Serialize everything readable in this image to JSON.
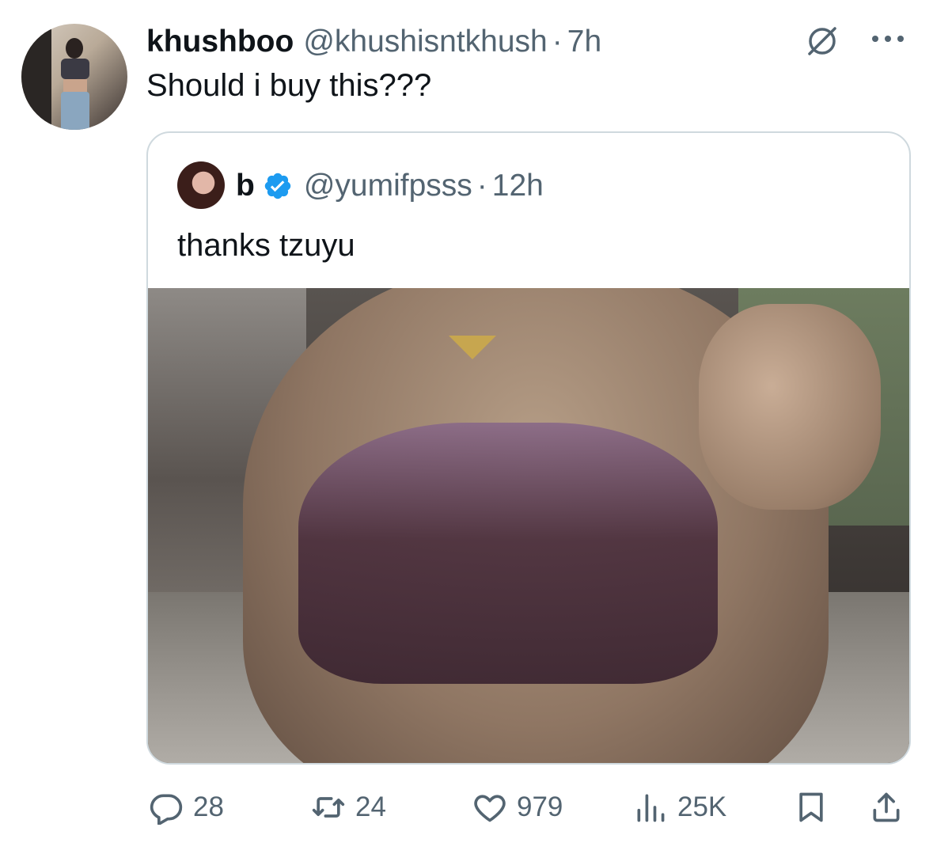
{
  "tweet": {
    "author_name": "khushboo",
    "author_handle": "@khushisntkhush",
    "separator": "·",
    "time": "7h",
    "text": "Should i buy this???",
    "avatar_icon": "user-avatar-photo",
    "grok_icon": "grok-icon",
    "more_icon": "more-horizontal-icon"
  },
  "quote": {
    "author_name": "b",
    "author_handle": "@yumifpsss",
    "separator": "·",
    "time": "12h",
    "verified": true,
    "verified_color": "#1d9bf0",
    "text": "thanks tzuyu",
    "media_icon": "attached-photo"
  },
  "actions": {
    "replies": "28",
    "reposts": "24",
    "likes": "979",
    "views": "25K",
    "icons": [
      "reply-icon",
      "repost-icon",
      "like-icon",
      "views-icon",
      "bookmark-icon",
      "share-icon"
    ]
  },
  "colors": {
    "text_primary": "#0f1419",
    "text_secondary": "#536471",
    "border": "#cfd9de",
    "verified": "#1d9bf0"
  }
}
